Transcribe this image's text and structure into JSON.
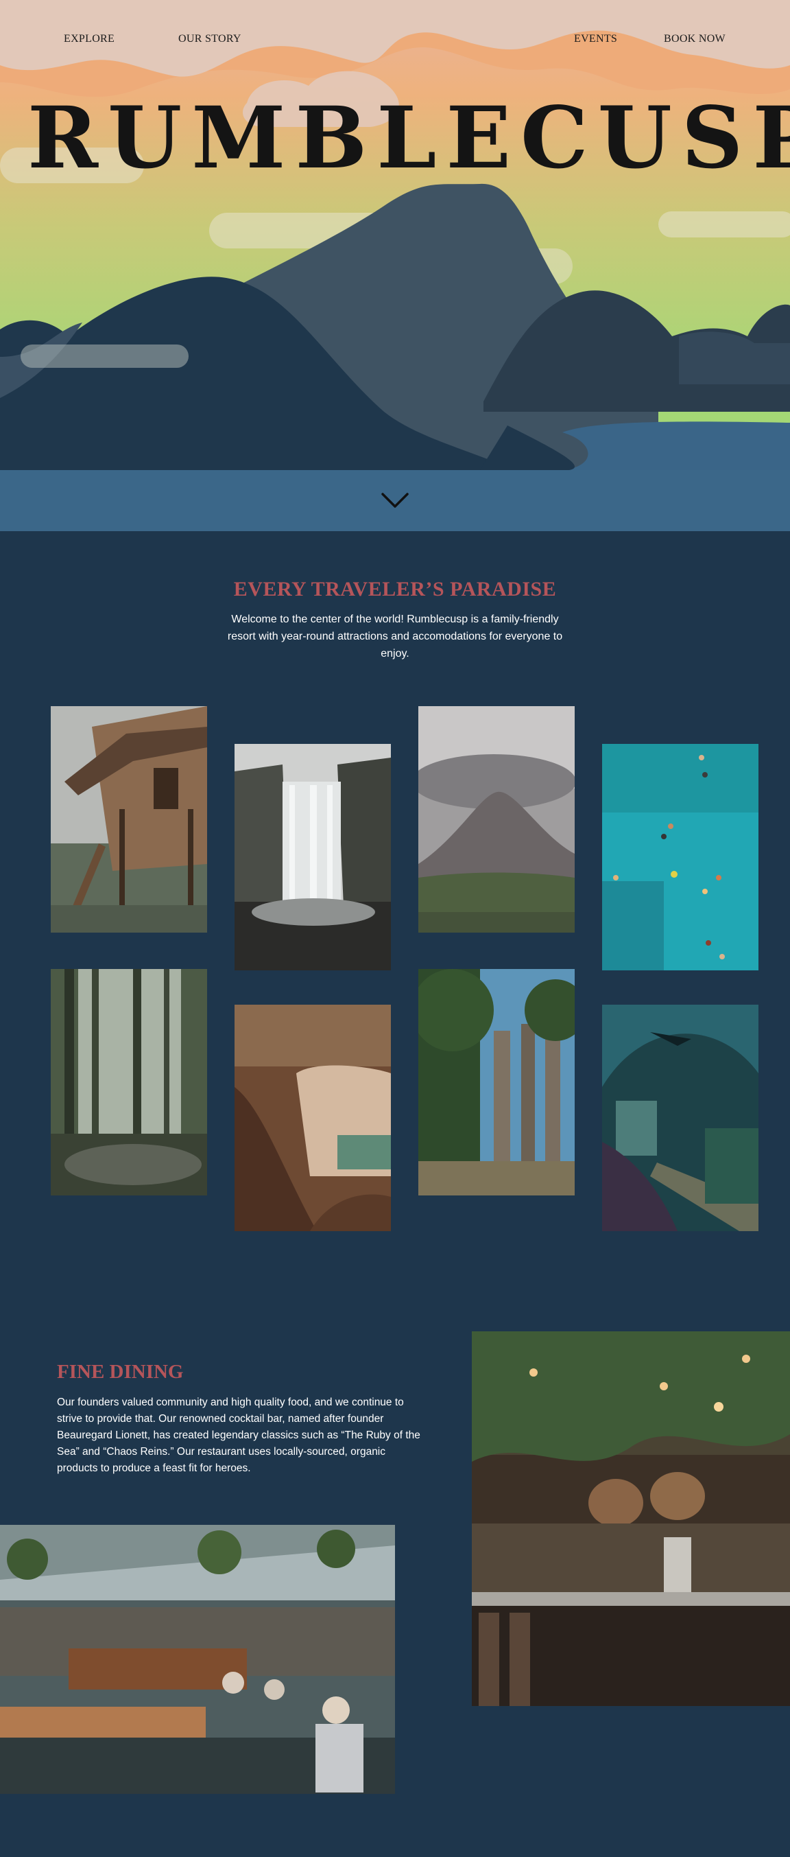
{
  "nav": {
    "left": [
      "EXPLORE",
      "OUR STORY"
    ],
    "right": [
      "EVENTS",
      "BOOK NOW"
    ]
  },
  "hero": {
    "brand": "RUMBLECUSP",
    "scroll_icon": "chevron-down-icon"
  },
  "intro": {
    "title": "EVERY TRAVELER’S PARADISE",
    "text": "Welcome to the center of the world! Rumblecusp is a family-friendly resort with year-round attractions and accomodations for everyone to enjoy."
  },
  "gallery": {
    "photos": [
      "treehouse-photo",
      "waterfall-photo",
      "volcano-photo",
      "lagoon-swimmers-photo",
      "rainforest-photo",
      "cave-photo",
      "ruins-photo",
      "aquarium-tunnel-photo"
    ]
  },
  "dining": {
    "title": "FINE DINING",
    "text": "Our founders valued community and high quality food, and we continue to strive to provide that. Our renowned cocktail bar, named after founder Beauregard Lionett, has created legendary classics such as “The Ruby of the Sea” and “Chaos Reins.” Our restaurant uses locally-sourced, organic products to produce a feast fit for heroes."
  },
  "colors": {
    "page_bg": "#1e364c",
    "accent": "#b5555a",
    "lake": "#3a6588"
  }
}
